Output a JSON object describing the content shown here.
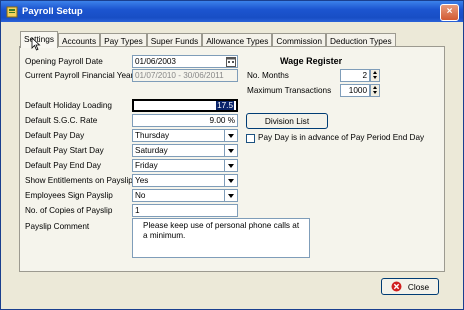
{
  "window": {
    "title": "Payroll Setup",
    "close_glyph": "×"
  },
  "tabs": [
    {
      "label": "Settings",
      "active": true
    },
    {
      "label": "Accounts"
    },
    {
      "label": "Pay Types"
    },
    {
      "label": "Super Funds"
    },
    {
      "label": "Allowance Types"
    },
    {
      "label": "Commission"
    },
    {
      "label": "Deduction Types"
    }
  ],
  "settings": {
    "opening_date_label": "Opening Payroll Date",
    "opening_date_value": "01/06/2003",
    "financial_year_label": "Current Payroll Financial Year",
    "financial_year_value": "01/07/2010 - 30/06/2011",
    "holiday_loading_label": "Default Holiday Loading",
    "holiday_loading_value": "17.5",
    "sgc_rate_label": "Default S.G.C. Rate",
    "sgc_rate_value": "9.00 %",
    "pay_day_label": "Default Pay Day",
    "pay_day_value": "Thursday",
    "pay_start_label": "Default Pay Start Day",
    "pay_start_value": "Saturday",
    "pay_end_label": "Default Pay End Day",
    "pay_end_value": "Friday",
    "entitlements_label": "Show Entitlements on Payslip",
    "entitlements_value": "Yes",
    "sign_payslip_label": "Employees Sign Payslip",
    "sign_payslip_value": "No",
    "copies_label": "No. of Copies of Payslip",
    "copies_value": "1",
    "comment_label": "Payslip Comment",
    "comment_value": "Please keep use of personal phone calls at a minimum."
  },
  "wage_register": {
    "title": "Wage Register",
    "months_label": "No. Months",
    "months_value": "2",
    "max_tx_label": "Maximum Transactions",
    "max_tx_value": "1000"
  },
  "division_list_label": "Division List",
  "pay_advance_label": "Pay Day is in advance of Pay Period End Day",
  "close_label": "Close",
  "colors": {
    "titlebar": "#1c55d0",
    "close_icon": "#d02020"
  }
}
